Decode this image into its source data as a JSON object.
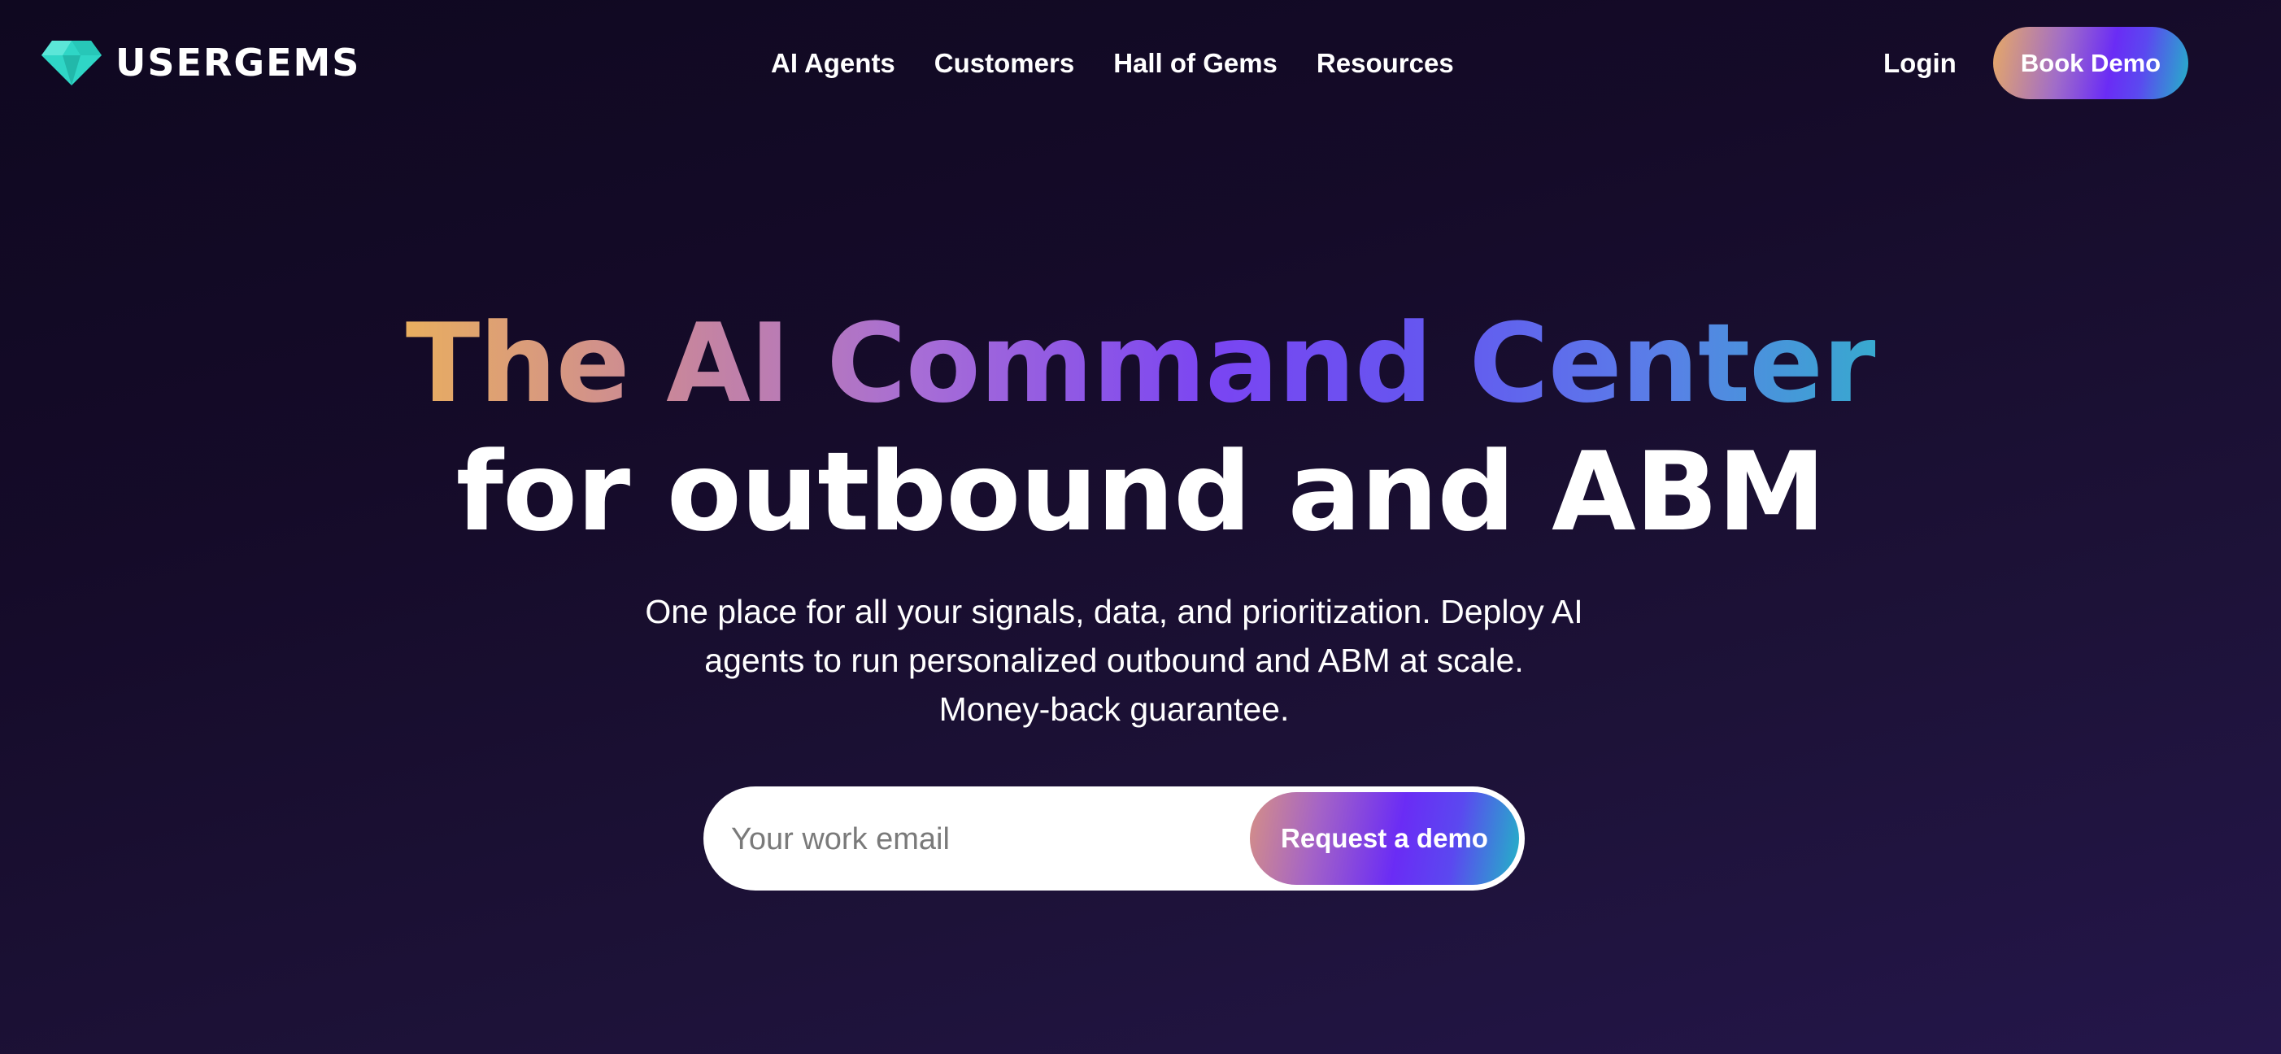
{
  "brand": {
    "name": "USERGEMS",
    "logo_icon": "gem-icon",
    "logo_color": "#2fd6c6"
  },
  "nav": {
    "links": [
      "AI Agents",
      "Customers",
      "Hall of Gems",
      "Resources"
    ],
    "login_label": "Login",
    "book_demo_label": "Book Demo"
  },
  "hero": {
    "title_line1": "The AI Command Center",
    "title_line2": "for outbound and ABM",
    "subtitle_line1": "One place for all your signals, data, and prioritization. Deploy AI",
    "subtitle_line2": "agents to run personalized outbound and ABM at scale.",
    "subtitle_line3": "Money-back guarantee."
  },
  "form": {
    "email_placeholder": "Your work email",
    "email_value": "",
    "submit_label": "Request a demo"
  },
  "colors": {
    "background": "#150b29",
    "gradient_start": "#e9ae5f",
    "gradient_mid": "#6a2cf5",
    "gradient_end": "#24b3c8"
  }
}
